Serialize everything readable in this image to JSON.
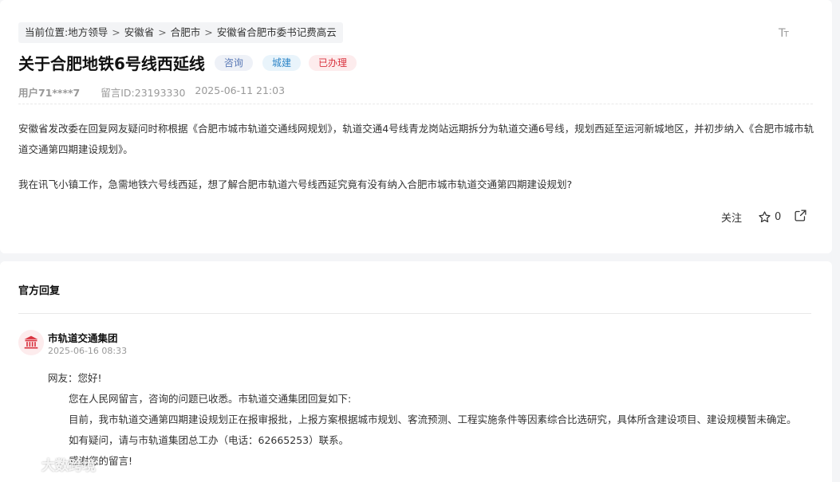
{
  "breadcrumb": {
    "label": "当前位置:",
    "items": [
      "地方领导",
      "安徽省",
      "合肥市",
      "安徽省合肥市委书记费高云"
    ],
    "separator": ">"
  },
  "font_toggle": {
    "big": "T",
    "small": "T"
  },
  "post": {
    "title": "关于合肥地铁6号线西延线",
    "tags": [
      "咨询",
      "城建",
      "已办理"
    ],
    "user": "用户71****7",
    "message_id": "留言ID:23193330",
    "datetime": "2025-06-11 21:03",
    "paragraphs": [
      "安徽省发改委在回复网友疑问时称根据《合肥市城市轨道交通线网规划》，轨道交通4号线青龙岗站远期拆分为轨道交通6号线，规划西延至运河新城地区，并初步纳入《合肥市城市轨道交通第四期建设规划》。",
      "我在讯飞小镇工作，急需地铁六号线西延，想了解合肥市轨道六号线西延究竟有没有纳入合肥市城市轨道交通第四期建设规划?"
    ],
    "actions": {
      "follow": "关注",
      "star_count": "0"
    }
  },
  "official_reply": {
    "section_title": "官方回复",
    "org": "市轨道交通集团",
    "date": "2025-06-16 08:33",
    "greeting": "网友：您好!",
    "lines": [
      "您在人民网留言，咨询的问题已收悉。市轨道交通集团回复如下:",
      "目前，我市轨道交通第四期建设规划正在报审报批，上报方案根据城市规划、客流预测、工程实施条件等因素综合比选研究，具体所含建设项目、建设规模暂未确定。",
      "如有疑问，请与市轨道集团总工办（电话：62665253）联系。",
      "感谢您的留言!"
    ]
  },
  "watermark": {
    "text": "大数跨境"
  },
  "colors": {
    "tag_consult": "#5a79b6",
    "tag_city": "#2f86c8",
    "tag_done": "#d9333f",
    "avatar_icon": "#d9333f"
  }
}
